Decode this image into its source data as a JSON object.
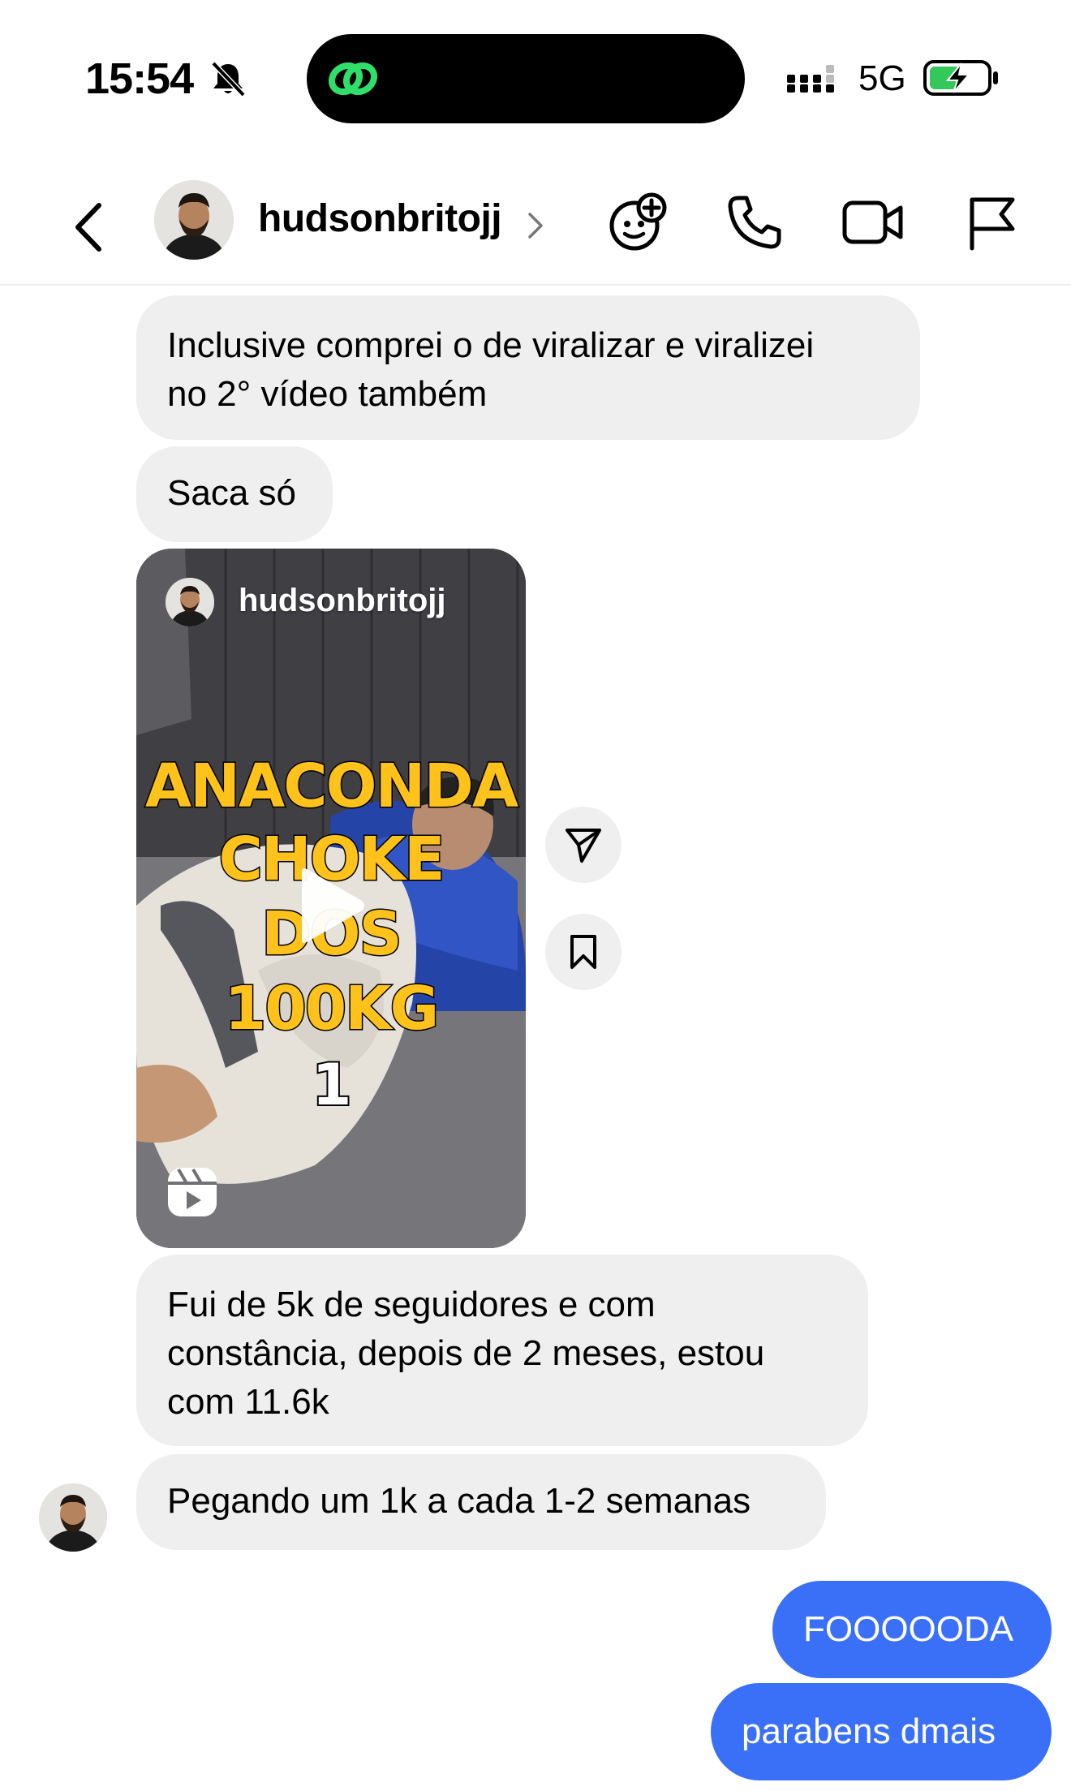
{
  "status_bar": {
    "time": "15:54",
    "network": "5G",
    "battery_level": 0.55
  },
  "header": {
    "username": "hudsonbritojj"
  },
  "messages": [
    {
      "id": 0,
      "type": "text",
      "from": "them",
      "text_lines": [
        "Inclusive comprei o de viralizar e viralizei",
        "no 2° vídeo também"
      ]
    },
    {
      "id": 1,
      "type": "text",
      "from": "them",
      "text_lines": [
        "Saca só"
      ]
    },
    {
      "id": 2,
      "type": "reel",
      "from": "them",
      "reel": {
        "username": "hudsonbritojj",
        "caption_lines": [
          "ANACONDA",
          "CHOKE",
          "DOS",
          "100KG"
        ],
        "overlay_number": "1"
      }
    },
    {
      "id": 3,
      "type": "text",
      "from": "them",
      "text_lines": [
        "Fui de 5k de seguidores e com",
        "constância, depois de 2 meses, estou",
        "com 11.6k"
      ]
    },
    {
      "id": 4,
      "type": "text",
      "from": "them",
      "text_lines": [
        "Pegando um 1k a cada 1-2 semanas"
      ]
    },
    {
      "id": 5,
      "type": "text",
      "from": "me",
      "text_lines": [
        "FOOOOODA"
      ]
    },
    {
      "id": 6,
      "type": "text",
      "from": "me",
      "text_lines": [
        "parabens dmais"
      ]
    }
  ],
  "colors": {
    "outgoing_bubble": "#3a6ff7",
    "incoming_bubble": "#efefef",
    "caption_fill": "#ffc21a",
    "island_icon": "#2ee06a",
    "battery_fill": "#34c759"
  },
  "icons": [
    "bell-slash-icon",
    "link-icon",
    "cellular-signal-icon",
    "battery-charging-icon",
    "back-chevron-icon",
    "chevron-right-icon",
    "effects-sticker-icon",
    "phone-icon",
    "video-camera-icon",
    "flag-icon",
    "send-icon",
    "bookmark-icon",
    "reels-icon",
    "play-icon"
  ]
}
